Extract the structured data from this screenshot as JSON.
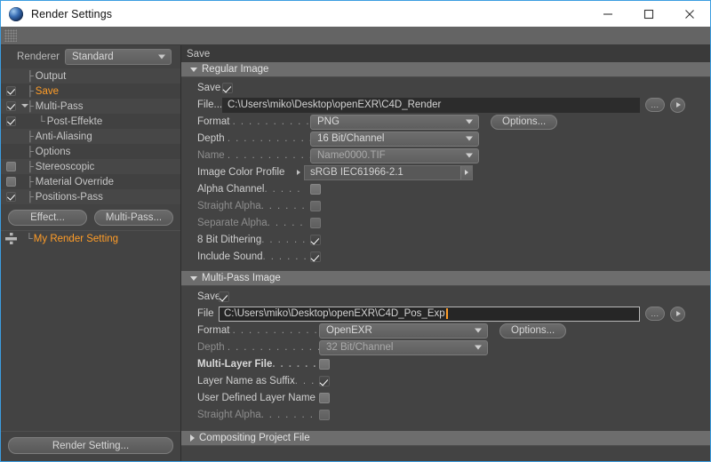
{
  "window": {
    "title": "Render Settings",
    "app_icon": "c4d-sphere-icon",
    "minimize": "minimize-icon",
    "maximize": "maximize-icon",
    "close": "close-icon"
  },
  "sidebar": {
    "renderer_label": "Renderer",
    "renderer_value": "Standard",
    "tree": [
      {
        "label": "Output",
        "check": "none",
        "selected": false,
        "child": false
      },
      {
        "label": "Save",
        "check": "checked",
        "selected": true,
        "child": false
      },
      {
        "label": "Multi-Pass",
        "check": "checked",
        "selected": false,
        "child": false,
        "twisty": true
      },
      {
        "label": "Post-Effekte",
        "check": "checked",
        "selected": false,
        "child": true
      },
      {
        "label": "Anti-Aliasing",
        "check": "none",
        "selected": false,
        "child": false
      },
      {
        "label": "Options",
        "check": "none",
        "selected": false,
        "child": false
      },
      {
        "label": "Stereoscopic",
        "check": "unchecked",
        "selected": false,
        "child": false
      },
      {
        "label": "Material Override",
        "check": "unchecked",
        "selected": false,
        "child": false
      },
      {
        "label": "Positions-Pass",
        "check": "checked",
        "selected": false,
        "child": false
      }
    ],
    "effect_button": "Effect...",
    "multipass_button": "Multi-Pass...",
    "setting_name": "My Render Setting",
    "render_setting_button": "Render Setting..."
  },
  "panel": {
    "title": "Save",
    "regular": {
      "group_title": "Regular Image",
      "save_label": "Save",
      "save_checked": true,
      "file_label": "File...",
      "file_value": "C:\\Users\\miko\\Desktop\\openEXR\\C4D_Render",
      "browse_button": "...",
      "play_button": "play-icon",
      "format_label": "Format",
      "format_dots": ". . . . . . . . . . . .",
      "format_value": "PNG",
      "options_button": "Options...",
      "depth_label": "Depth",
      "depth_dots": ". . . . . . . . . . . . .",
      "depth_value": "16 Bit/Channel",
      "name_label": "Name",
      "name_dots": ". . . . . . . . . . . . .",
      "name_value": "Name0000.TIF",
      "profile_label": "Image Color Profile",
      "profile_value": "sRGB IEC61966-2.1",
      "checks": [
        {
          "label": "Alpha Channel",
          "dots": ". . . . .",
          "checked": false,
          "disabled": false
        },
        {
          "label": "Straight Alpha",
          "dots": ". . . . . .",
          "checked": false,
          "disabled": true
        },
        {
          "label": "Separate Alpha",
          "dots": ". . . . .",
          "checked": false,
          "disabled": true
        },
        {
          "label": "8 Bit Dithering",
          "dots": ". . . . . .",
          "checked": true,
          "disabled": false
        },
        {
          "label": "Include Sound",
          "dots": ". . . . . .",
          "checked": true,
          "disabled": false
        }
      ]
    },
    "multipass": {
      "group_title": "Multi-Pass Image",
      "save_label": "Save",
      "save_checked": true,
      "file_label": "File",
      "file_value": "C:\\Users\\miko\\Desktop\\openEXR\\C4D_Pos_Exp",
      "file_focused": true,
      "browse_button": "...",
      "play_button": "play-icon",
      "format_label": "Format",
      "format_dots": ". . . . . . . . . . . . .",
      "format_value": "OpenEXR",
      "options_button": "Options...",
      "depth_label": "Depth",
      "depth_dots": ". . . . . . . . . . . . . .",
      "depth_value": "32 Bit/Channel",
      "checks": [
        {
          "label": "Multi-Layer File",
          "dots": ". . . . . . . .",
          "checked": false,
          "disabled": false,
          "bold": true
        },
        {
          "label": "Layer Name as Suffix",
          "dots": ". . . .",
          "checked": true,
          "disabled": false,
          "bold": false
        },
        {
          "label": "User Defined Layer Name",
          "dots": "",
          "checked": false,
          "disabled": false,
          "bold": false
        },
        {
          "label": "Straight Alpha",
          "dots": ". . . . . . . . .",
          "checked": false,
          "disabled": true,
          "bold": false
        }
      ]
    },
    "compositing": {
      "group_title": "Compositing Project File"
    }
  },
  "colors": {
    "accent_orange": "#ff9d28",
    "window_border": "#3c9de0",
    "panel_bg": "#434343",
    "group_head": "#6d6d6d"
  }
}
